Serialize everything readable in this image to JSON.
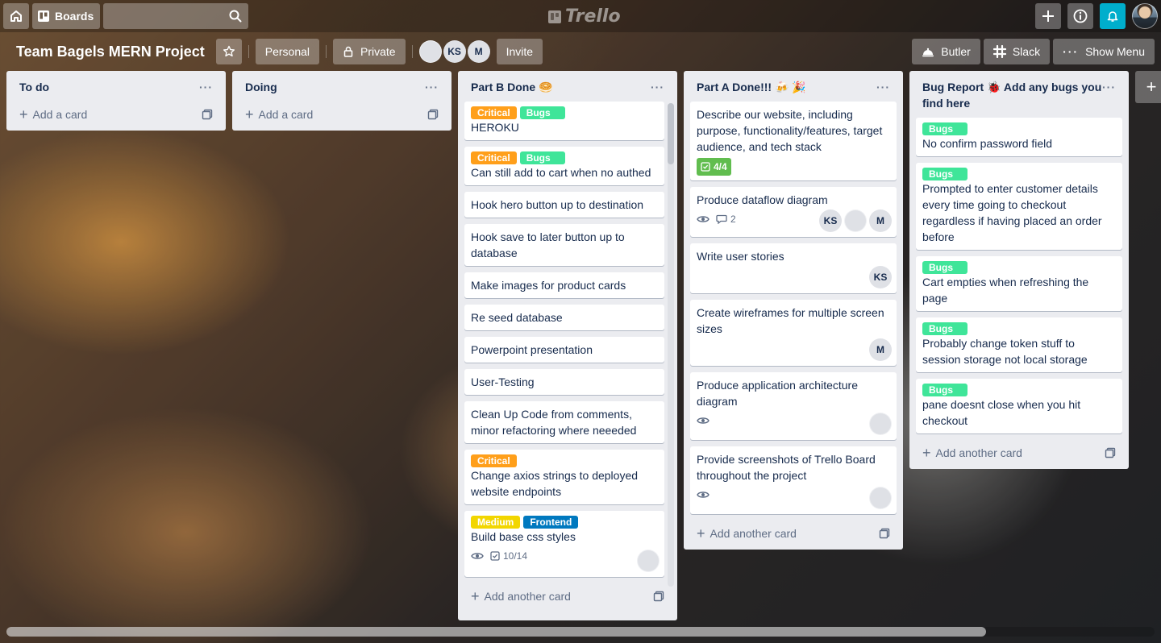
{
  "header": {
    "boards_label": "Boards",
    "logo": "Trello"
  },
  "board": {
    "title": "Team Bagels MERN Project",
    "visibility_team": "Personal",
    "visibility": "Private",
    "members": [
      "KS",
      "M"
    ],
    "invite_label": "Invite",
    "butler_label": "Butler",
    "slack_label": "Slack",
    "menu_label": "Show Menu"
  },
  "lists": [
    {
      "title": "To do",
      "add_label": "Add a card"
    },
    {
      "title": "Doing",
      "add_label": "Add a card"
    },
    {
      "title": "Part B Done 🥯",
      "add_label": "Add another card",
      "cards": [
        {
          "labels": [
            "Critical",
            "Bugs"
          ],
          "title": "HEROKU"
        },
        {
          "labels": [
            "Critical",
            "Bugs"
          ],
          "title": "Can still add to cart when no authed"
        },
        {
          "title": "Hook hero button up to destination"
        },
        {
          "title": "Hook save to later button up to database"
        },
        {
          "title": "Make images for product cards"
        },
        {
          "title": "Re seed database"
        },
        {
          "title": "Powerpoint presentation"
        },
        {
          "title": "User-Testing"
        },
        {
          "title": "Clean Up Code from comments, minor refactoring where neeeded"
        },
        {
          "labels": [
            "Critical"
          ],
          "title": "Change axios strings to deployed website endpoints"
        },
        {
          "labels": [
            "Medium",
            "Frontend"
          ],
          "title": "Build base css styles",
          "checklist": "10/14"
        }
      ]
    },
    {
      "title": "Part A Done!!! 🍻 🎉",
      "add_label": "Add another card",
      "cards": [
        {
          "title": "Describe our website, including purpose, functionality/features, target audience, and tech stack",
          "checklist": "4/4"
        },
        {
          "title": "Produce dataflow diagram",
          "comments": "2",
          "members": [
            "KS",
            "M"
          ]
        },
        {
          "title": "Write user stories",
          "members": [
            "KS"
          ]
        },
        {
          "title": "Create wireframes for multiple screen sizes",
          "members": [
            "M"
          ]
        },
        {
          "title": "Produce application architecture diagram"
        },
        {
          "title": "Provide screenshots of Trello Board throughout the project"
        }
      ]
    },
    {
      "title": "Bug Report 🐞 Add any bugs you find here",
      "add_label": "Add another card",
      "cards": [
        {
          "labels": [
            "Bugs"
          ],
          "title": "No confirm password field"
        },
        {
          "labels": [
            "Bugs"
          ],
          "title": "Prompted to enter customer details every time going to checkout regardless if having placed an order before"
        },
        {
          "labels": [
            "Bugs"
          ],
          "title": "Cart empties when refreshing the page"
        },
        {
          "labels": [
            "Bugs"
          ],
          "title": "Probably change token stuff to session storage not local storage"
        },
        {
          "labels": [
            "Bugs"
          ],
          "title": "pane doesnt close when you hit checkout"
        }
      ]
    }
  ],
  "colors": {
    "critical": "#ff9f1a",
    "bugs": "#3fe599",
    "medium": "#f2d600",
    "frontend": "#0079bf",
    "checklist_done": "#61bd4f",
    "notification": "#00aecc"
  }
}
